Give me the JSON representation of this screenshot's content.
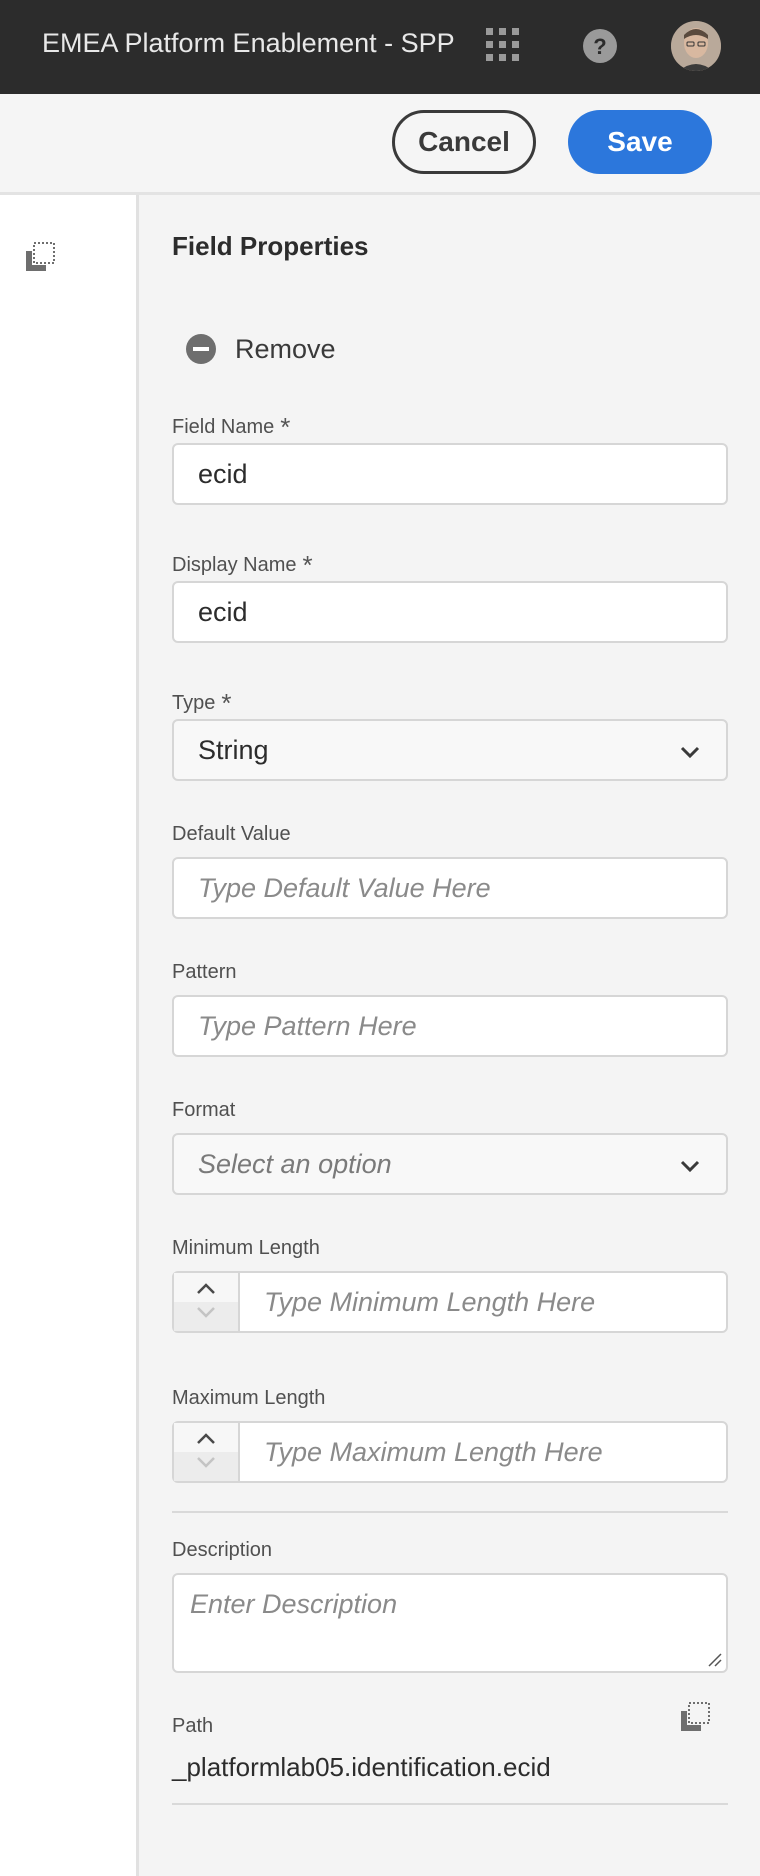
{
  "app": {
    "title": "EMEA Platform Enablement - SPP",
    "icons": [
      "apps-icon",
      "help-icon",
      "avatar"
    ]
  },
  "actions": {
    "cancel_label": "Cancel",
    "save_label": "Save"
  },
  "panel": {
    "heading": "Field Properties",
    "remove_label": "Remove",
    "field_name": {
      "label": "Field Name",
      "required": "*",
      "value": "ecid"
    },
    "display_name": {
      "label": "Display Name",
      "required": "*",
      "value": "ecid"
    },
    "type": {
      "label": "Type",
      "required": "*",
      "value": "String"
    },
    "default_value": {
      "label": "Default Value",
      "placeholder": "Type Default Value Here"
    },
    "pattern": {
      "label": "Pattern",
      "placeholder": "Type Pattern Here"
    },
    "format": {
      "label": "Format",
      "placeholder": "Select an option"
    },
    "min_length": {
      "label": "Minimum Length",
      "placeholder": "Type Minimum Length Here"
    },
    "max_length": {
      "label": "Maximum Length",
      "placeholder": "Type Maximum Length Here"
    },
    "description": {
      "label": "Description",
      "placeholder": "Enter Description"
    },
    "path": {
      "label": "Path",
      "value": "_platformlab05.identification.ecid"
    }
  },
  "colors": {
    "topbar": "#2c2c2c",
    "accent": "#2c77dc",
    "panel_bg": "#f4f4f4"
  }
}
